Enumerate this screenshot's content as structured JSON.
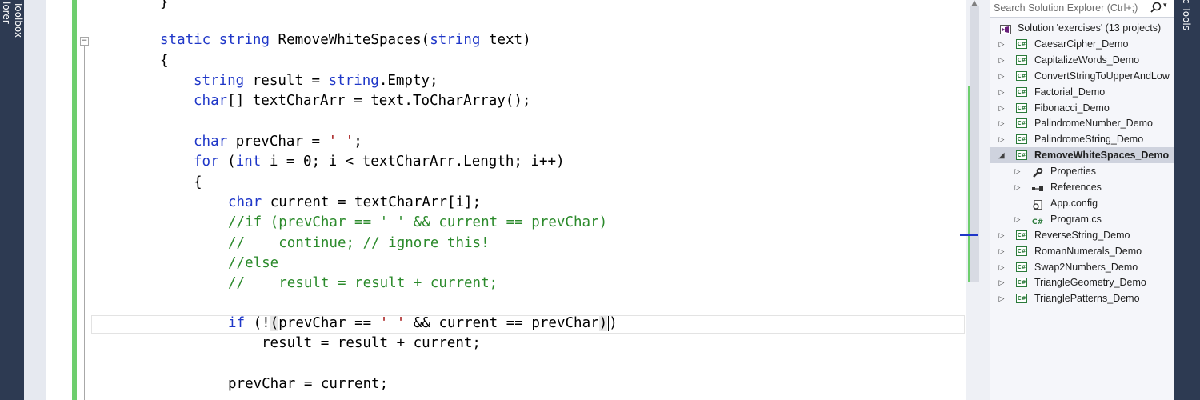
{
  "left_tabs": {
    "explorer_label": "lorer",
    "toolbox_label": "Toolbox"
  },
  "right_tab": {
    "label": "c Tools"
  },
  "code": {
    "l0": {
      "p": "}"
    },
    "l1": {
      "kw1": "static",
      "kw2": "string",
      "name": "RemoveWhiteSpaces(",
      "kw3": "string",
      "rest": "text)"
    },
    "l2": {
      "p": "{"
    },
    "l3": {
      "kw1": "string",
      "mid": "result =",
      "kw2": "string",
      "rest": ".Empty;"
    },
    "l4": {
      "kw1": "char",
      "rest": "[] textCharArr = text.ToCharArray();"
    },
    "l5": {
      "kw1": "char",
      "mid": "prevChar =",
      "str": "' '",
      "rest": ";"
    },
    "l6": {
      "kw1": "for",
      "mid": "(",
      "kw2": "int",
      "rest": "i = 0; i < textCharArr.Length; i++)"
    },
    "l7": {
      "p": "{"
    },
    "l8": {
      "kw1": "char",
      "rest": "current = textCharArr[i];"
    },
    "l9": {
      "cm": "//if (prevChar == ' ' && current == prevChar)"
    },
    "l10": {
      "cm": "//    continue; // ignore this!"
    },
    "l11": {
      "cm": "//else"
    },
    "l12": {
      "cm": "//    result = result + current;"
    },
    "l13": {
      "kw1": "if",
      "a": "(!",
      "b": "(",
      "c": "prevChar ==",
      "str": "' '",
      "d": "&& current == prevChar",
      "e": ")",
      "f": ")"
    },
    "l14": {
      "p": "result = result + current;"
    },
    "l15": {
      "p": "prevChar = current;"
    }
  },
  "solution_explorer": {
    "search_placeholder": "Search Solution Explorer (Ctrl+;)",
    "solution_label": "Solution 'exercises' (13 projects)",
    "projects": [
      {
        "label": "CaesarCipher_Demo"
      },
      {
        "label": "CapitalizeWords_Demo"
      },
      {
        "label": "ConvertStringToUpperAndLow"
      },
      {
        "label": "Factorial_Demo"
      },
      {
        "label": "Fibonacci_Demo"
      },
      {
        "label": "PalindromeNumber_Demo"
      },
      {
        "label": "PalindromeString_Demo"
      },
      {
        "label": "RemoveWhiteSpaces_Demo",
        "expanded": true,
        "selected": true
      },
      {
        "label": "ReverseString_Demo"
      },
      {
        "label": "RomanNumerals_Demo"
      },
      {
        "label": "Swap2Numbers_Demo"
      },
      {
        "label": "TriangleGeometry_Demo"
      },
      {
        "label": "TrianglePatterns_Demo"
      }
    ],
    "children": [
      {
        "label": "Properties",
        "icon": "wrench-icon"
      },
      {
        "label": "References",
        "icon": "references-icon"
      },
      {
        "label": "App.config",
        "icon": "config-file-icon"
      },
      {
        "label": "Program.cs",
        "icon": "csharp-file-icon"
      }
    ]
  },
  "colors": {
    "keyword": "#1f37c8",
    "comment": "#2b8a2b",
    "string": "#a31515",
    "change_bar": "#6ece6e",
    "tool_strip": "#2d3a52"
  }
}
